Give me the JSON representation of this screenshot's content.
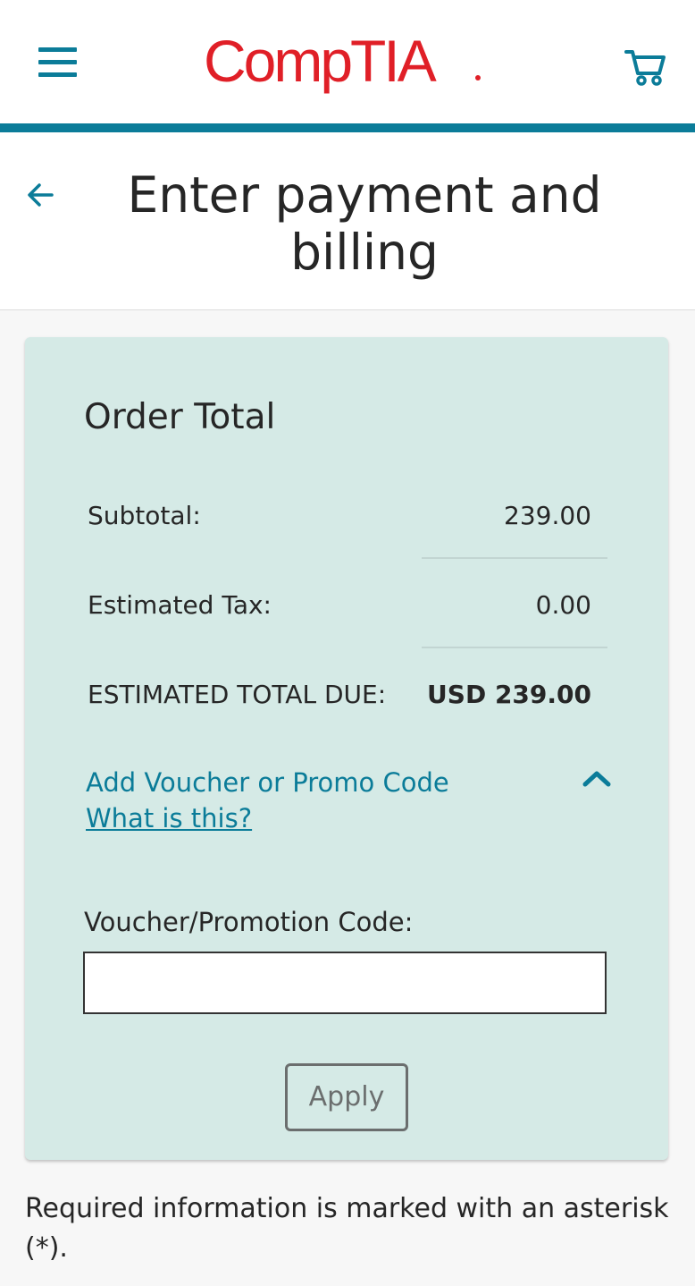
{
  "brand": {
    "logo_text": "CompTIA",
    "logo_color": "#e01f27",
    "accent_color": "#0b7c99",
    "menu_icon": "hamburger-menu-icon",
    "cart_icon": "shopping-cart-icon"
  },
  "header": {
    "title": "Enter payment and billing",
    "back_icon": "arrow-left-icon"
  },
  "order_total": {
    "title": "Order Total",
    "rows": [
      {
        "label": "Subtotal:",
        "value": "239.00"
      },
      {
        "label": "Estimated Tax:",
        "value": "0.00"
      },
      {
        "label": "ESTIMATED TOTAL DUE:",
        "value": "USD 239.00"
      }
    ],
    "promo_toggle_label": "Add Voucher or Promo Code",
    "promo_help_label": "What is this?",
    "promo_toggle_icon": "chevron-up-icon",
    "promo_code_label": "Voucher/Promotion Code:",
    "promo_code_value": "",
    "promo_code_placeholder": "",
    "apply_label": "Apply",
    "card_background": "#d5eae6"
  },
  "footer_note": "Required information is marked with an asterisk (*)."
}
